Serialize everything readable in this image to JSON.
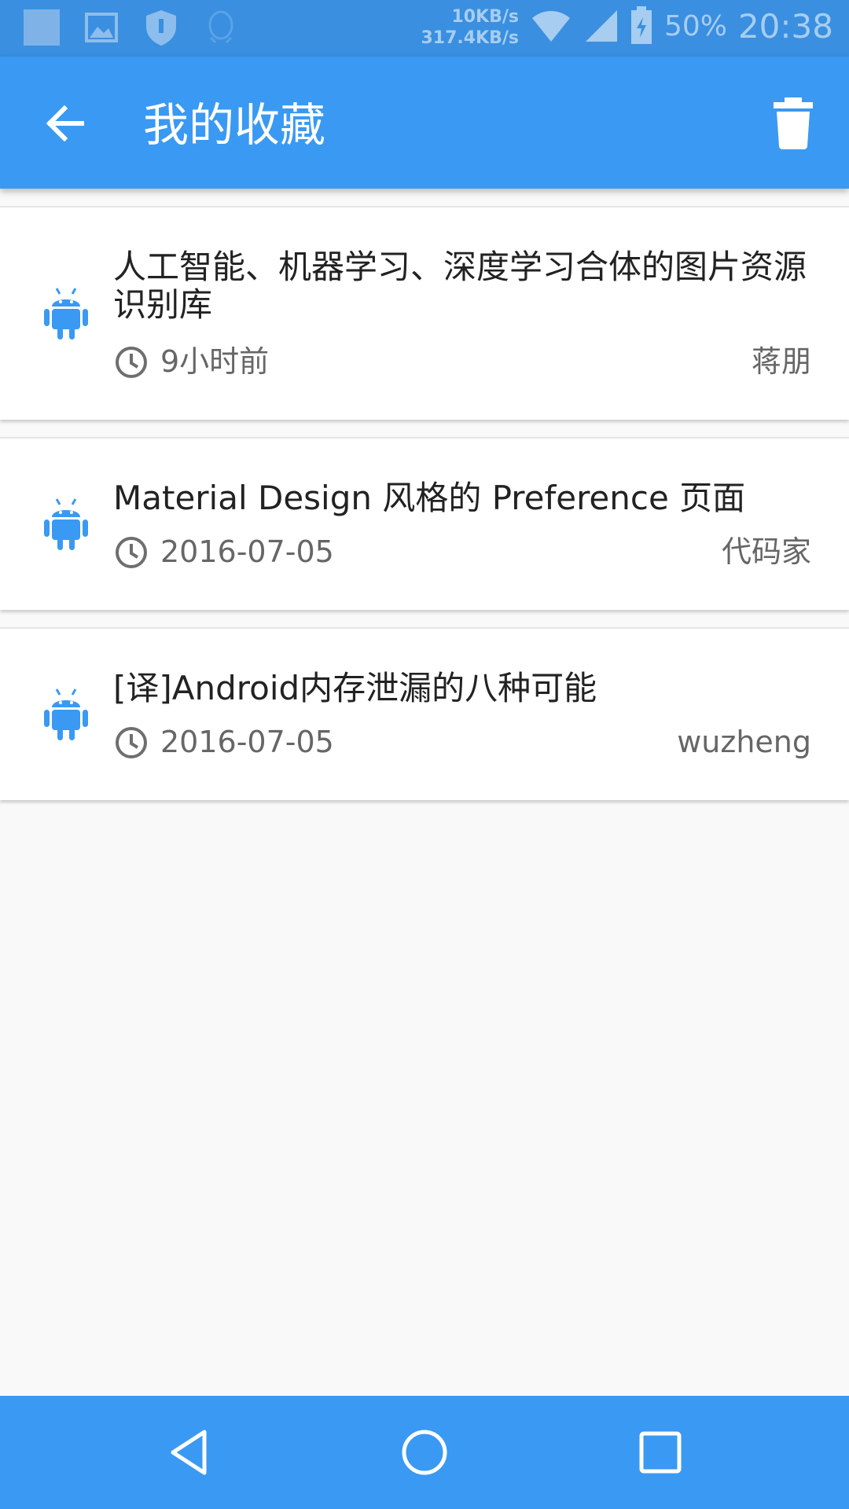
{
  "status_bar": {
    "net_up": "10KB/s",
    "net_down": "317.4KB/s",
    "battery": "50%",
    "time": "20:38"
  },
  "app_bar": {
    "title": "我的收藏"
  },
  "favorites": [
    {
      "title": "人工智能、机器学习、深度学习合体的图片资源识别库",
      "date": "9小时前",
      "author": "蒋朋"
    },
    {
      "title": "Material Design 风格的 Preference 页面",
      "date": "2016-07-05",
      "author": "代码家"
    },
    {
      "title": "[译]Android内存泄漏的八种可能",
      "date": "2016-07-05",
      "author": "wuzheng"
    }
  ],
  "colors": {
    "primary": "#3a99f2",
    "status_bar": "#3a8fe0",
    "background": "#f9f9f9",
    "icon_accent": "#3a99f2"
  },
  "icons": {
    "back": "arrow-left-icon",
    "delete": "trash-icon",
    "item": "android-icon",
    "time": "clock-icon",
    "nav_back": "triangle-back-icon",
    "nav_home": "circle-home-icon",
    "nav_recents": "square-recents-icon"
  }
}
